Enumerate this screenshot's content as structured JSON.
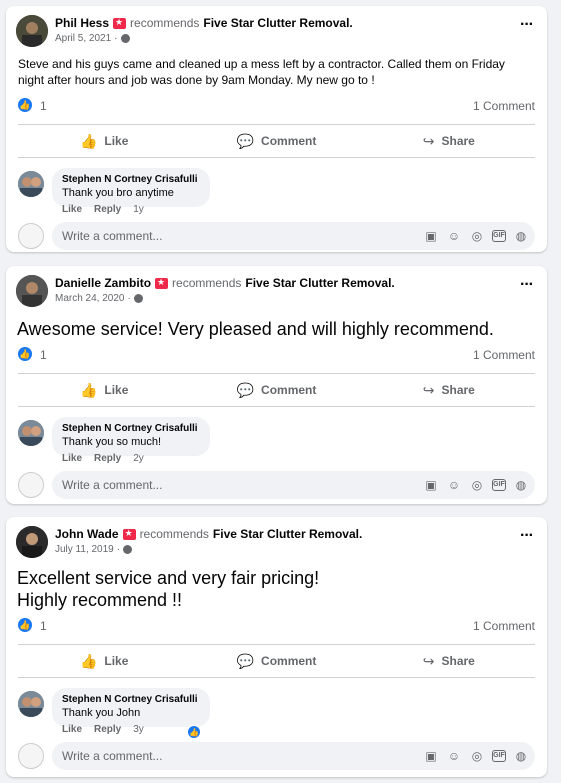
{
  "recommends_text": "recommends",
  "page_name": "Five Star Clutter Removal.",
  "actions": {
    "like": "Like",
    "comment": "Comment",
    "share": "Share"
  },
  "comment_actions": {
    "like": "Like",
    "reply": "Reply"
  },
  "write_placeholder": "Write a comment...",
  "colors": {
    "accent": "#1877f2",
    "recommend_badge": "#f02849",
    "background": "#f0f2f5"
  },
  "icons": [
    "more-icon",
    "globe-icon",
    "like-icon",
    "comment-icon",
    "share-icon",
    "sticker-icon",
    "emoji-icon",
    "camera-icon",
    "gif-icon",
    "avatar-sticker-icon"
  ],
  "posts": [
    {
      "author": "Phil Hess",
      "date": "April 5, 2021",
      "text": "Steve and his guys came and cleaned up a mess left by a contractor. Called them on Friday night after hours and job was done by 9am Monday. My new go to !",
      "likes": "1",
      "comment_count": "1 Comment",
      "reply": {
        "author": "Stephen N Cortney Crisafulli",
        "text": "Thank you bro anytime",
        "time": "1y"
      }
    },
    {
      "author": "Danielle Zambito",
      "date": "March 24, 2020",
      "text": "Awesome service! Very pleased and will highly recommend.",
      "likes": "1",
      "comment_count": "1 Comment",
      "reply": {
        "author": "Stephen N Cortney Crisafulli",
        "text": "Thank you so much!",
        "time": "2y"
      }
    },
    {
      "author": "John Wade",
      "date": "July 11, 2019",
      "text_line1": "Excellent service and very fair pricing!",
      "text_line2": "Highly recommend !!",
      "likes": "1",
      "comment_count": "1 Comment",
      "reply": {
        "author": "Stephen N Cortney Crisafulli",
        "text": "Thank you John",
        "time": "3y"
      }
    }
  ]
}
